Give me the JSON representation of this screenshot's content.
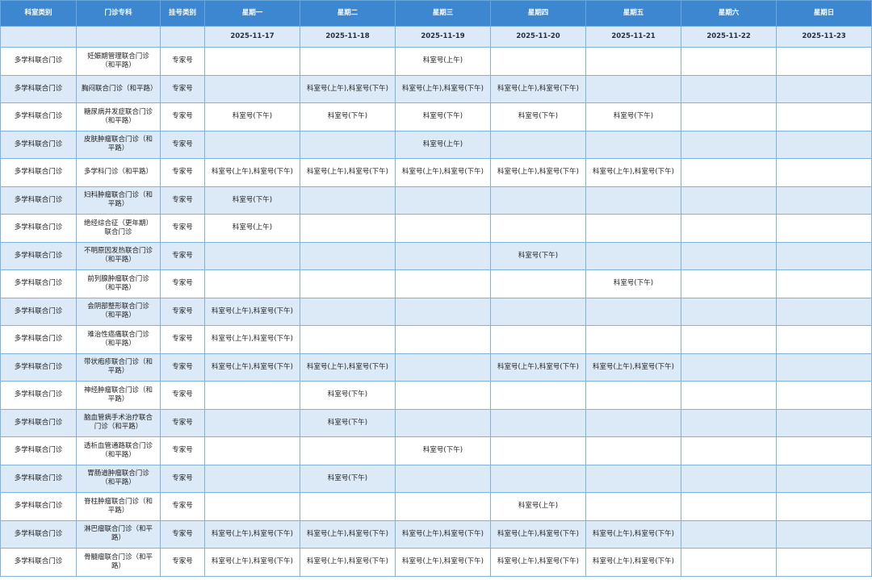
{
  "header": {
    "columns": [
      "科室类别",
      "门诊专科",
      "挂号类别",
      "星期一",
      "星期二",
      "星期三",
      "星期四",
      "星期五",
      "星期六",
      "星期日"
    ],
    "dates": [
      "2025-11-17",
      "2025-11-18",
      "2025-11-19",
      "2025-11-20",
      "2025-11-21",
      "2025-11-22",
      "2025-11-23"
    ]
  },
  "rows": [
    {
      "dept": "多学科联合门诊",
      "clinic": "妊娠期管理联合门诊（和平路）",
      "type": "专家号",
      "days": [
        "",
        "",
        "科室号(上午)",
        "",
        "",
        "",
        ""
      ]
    },
    {
      "dept": "多学科联合门诊",
      "clinic": "胸闷联合门诊（和平路）",
      "type": "专家号",
      "days": [
        "",
        "科室号(上午),科室号(下午)",
        "科室号(上午),科室号(下午)",
        "科室号(上午),科室号(下午)",
        "",
        "",
        ""
      ]
    },
    {
      "dept": "多学科联合门诊",
      "clinic": "糖尿病并发症联合门诊（和平路）",
      "type": "专家号",
      "days": [
        "科室号(下午)",
        "科室号(下午)",
        "科室号(下午)",
        "科室号(下午)",
        "科室号(下午)",
        "",
        ""
      ]
    },
    {
      "dept": "多学科联合门诊",
      "clinic": "皮肤肿瘤联合门诊（和平路）",
      "type": "专家号",
      "days": [
        "",
        "",
        "科室号(上午)",
        "",
        "",
        "",
        ""
      ]
    },
    {
      "dept": "多学科联合门诊",
      "clinic": "多学科门诊（和平路）",
      "type": "专家号",
      "days": [
        "科室号(上午),科室号(下午)",
        "科室号(上午),科室号(下午)",
        "科室号(上午),科室号(下午)",
        "科室号(上午),科室号(下午)",
        "科室号(上午),科室号(下午)",
        "",
        ""
      ]
    },
    {
      "dept": "多学科联合门诊",
      "clinic": "妇科肿瘤联合门诊（和平路）",
      "type": "专家号",
      "days": [
        "科室号(下午)",
        "",
        "",
        "",
        "",
        "",
        ""
      ]
    },
    {
      "dept": "多学科联合门诊",
      "clinic": "绝经综合征（更年期）联合门诊",
      "type": "专家号",
      "days": [
        "科室号(上午)",
        "",
        "",
        "",
        "",
        "",
        ""
      ]
    },
    {
      "dept": "多学科联合门诊",
      "clinic": "不明原因发热联合门诊（和平路）",
      "type": "专家号",
      "days": [
        "",
        "",
        "",
        "科室号(下午)",
        "",
        "",
        ""
      ]
    },
    {
      "dept": "多学科联合门诊",
      "clinic": "前列腺肿瘤联合门诊（和平路）",
      "type": "专家号",
      "days": [
        "",
        "",
        "",
        "",
        "科室号(下午)",
        "",
        ""
      ]
    },
    {
      "dept": "多学科联合门诊",
      "clinic": "会阴部整形联合门诊（和平路）",
      "type": "专家号",
      "days": [
        "科室号(上午),科室号(下午)",
        "",
        "",
        "",
        "",
        "",
        ""
      ]
    },
    {
      "dept": "多学科联合门诊",
      "clinic": "难治性癌痛联合门诊（和平路）",
      "type": "专家号",
      "days": [
        "科室号(上午),科室号(下午)",
        "",
        "",
        "",
        "",
        "",
        ""
      ]
    },
    {
      "dept": "多学科联合门诊",
      "clinic": "带状疱疹联合门诊（和平路）",
      "type": "专家号",
      "days": [
        "科室号(上午),科室号(下午)",
        "科室号(上午),科室号(下午)",
        "",
        "科室号(上午),科室号(下午)",
        "科室号(上午),科室号(下午)",
        "",
        ""
      ]
    },
    {
      "dept": "多学科联合门诊",
      "clinic": "神经肿瘤联合门诊（和平路）",
      "type": "专家号",
      "days": [
        "",
        "科室号(下午)",
        "",
        "",
        "",
        "",
        ""
      ]
    },
    {
      "dept": "多学科联合门诊",
      "clinic": "脑血管病手术治疗联合门诊（和平路）",
      "type": "专家号",
      "days": [
        "",
        "科室号(下午)",
        "",
        "",
        "",
        "",
        ""
      ]
    },
    {
      "dept": "多学科联合门诊",
      "clinic": "透析血管通路联合门诊（和平路）",
      "type": "专家号",
      "days": [
        "",
        "",
        "科室号(下午)",
        "",
        "",
        "",
        ""
      ]
    },
    {
      "dept": "多学科联合门诊",
      "clinic": "胃肠道肿瘤联合门诊（和平路）",
      "type": "专家号",
      "days": [
        "",
        "科室号(下午)",
        "",
        "",
        "",
        "",
        ""
      ]
    },
    {
      "dept": "多学科联合门诊",
      "clinic": "脊柱肿瘤联合门诊（和平路）",
      "type": "专家号",
      "days": [
        "",
        "",
        "",
        "科室号(上午)",
        "",
        "",
        ""
      ]
    },
    {
      "dept": "多学科联合门诊",
      "clinic": "淋巴瘤联合门诊（和平路）",
      "type": "专家号",
      "days": [
        "科室号(上午),科室号(下午)",
        "科室号(上午),科室号(下午)",
        "科室号(上午),科室号(下午)",
        "科室号(上午),科室号(下午)",
        "科室号(上午),科室号(下午)",
        "",
        ""
      ]
    },
    {
      "dept": "多学科联合门诊",
      "clinic": "骨髓瘤联合门诊（和平路）",
      "type": "专家号",
      "days": [
        "科室号(上午),科室号(下午)",
        "科室号(上午),科室号(下午)",
        "科室号(上午),科室号(下午)",
        "科室号(上午),科室号(下午)",
        "科室号(上午),科室号(下午)",
        "",
        ""
      ]
    }
  ]
}
